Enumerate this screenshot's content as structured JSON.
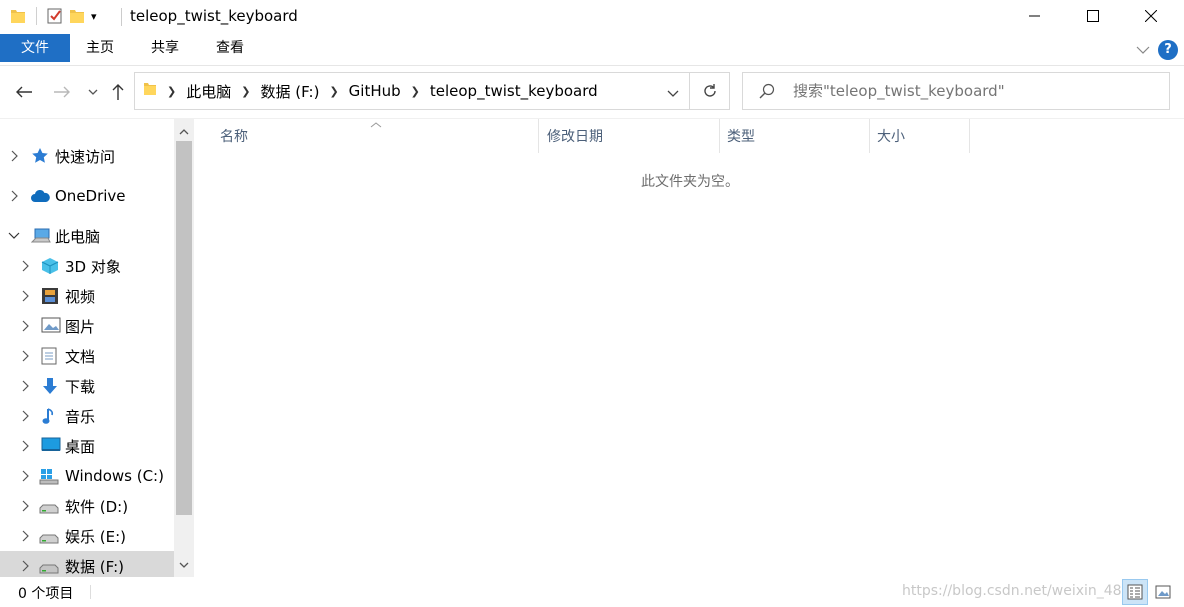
{
  "window": {
    "title": "teleop_twist_keyboard",
    "qat_dropdown": "▾"
  },
  "ribbon": {
    "tabs": [
      "文件",
      "主页",
      "共享",
      "查看"
    ],
    "help": "?"
  },
  "address": {
    "crumbs": [
      "此电脑",
      "数据 (F:)",
      "GitHub",
      "teleop_twist_keyboard"
    ]
  },
  "search": {
    "placeholder": "搜索\"teleop_twist_keyboard\""
  },
  "sidebar": {
    "items": [
      {
        "label": "快速访问",
        "icon": "star-icon"
      },
      {
        "label": "OneDrive",
        "icon": "cloud-icon"
      },
      {
        "label": "此电脑",
        "icon": "computer-icon"
      },
      {
        "label": "3D 对象",
        "icon": "cube-icon"
      },
      {
        "label": "视频",
        "icon": "film-icon"
      },
      {
        "label": "图片",
        "icon": "picture-icon"
      },
      {
        "label": "文档",
        "icon": "document-icon"
      },
      {
        "label": "下载",
        "icon": "download-icon"
      },
      {
        "label": "音乐",
        "icon": "music-icon"
      },
      {
        "label": "桌面",
        "icon": "desktop-icon"
      },
      {
        "label": "Windows (C:)",
        "icon": "windows-drive-icon"
      },
      {
        "label": "软件 (D:)",
        "icon": "drive-icon"
      },
      {
        "label": "娱乐 (E:)",
        "icon": "drive-icon"
      },
      {
        "label": "数据 (F:)",
        "icon": "drive-icon"
      }
    ]
  },
  "columns": [
    "名称",
    "修改日期",
    "类型",
    "大小"
  ],
  "empty_message": "此文件夹为空。",
  "status": {
    "item_count": "0 个项目",
    "watermark": "https://blog.csdn.net/weixin_48"
  },
  "colors": {
    "accent": "#1f6fc5",
    "selected_nav": "#d9d9d9",
    "column_header_text": "#4c607a"
  }
}
